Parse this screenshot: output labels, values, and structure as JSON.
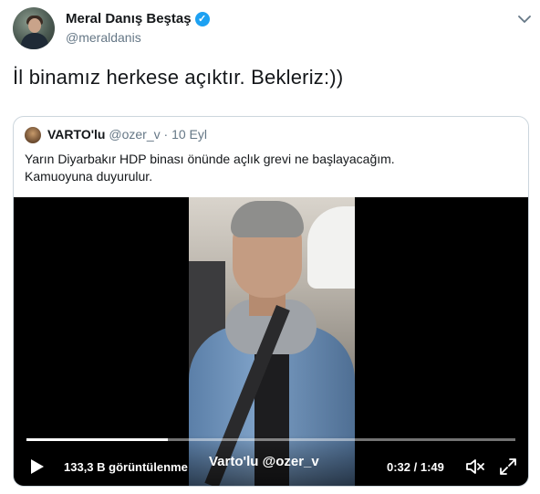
{
  "tweet": {
    "author_name": "Meral Danış Beştaş",
    "author_handle": "@meraldanis",
    "text": "İl binamız herkese açıktır. Bekleriz:))",
    "verified_icon": "verified-badge-icon",
    "more_icon": "chevron-down-icon"
  },
  "quote": {
    "author_name": "VARTO'lu",
    "author_handle": "@ozer_v",
    "separator": " · ",
    "date": "10 Eyl",
    "text_lines": [
      "Yarın Diyarbakır HDP binası önünde açlık grevi ne başlayacağım.",
      "Kamuoyuna duyurulur."
    ]
  },
  "video": {
    "views": "133,3 B görüntülenme",
    "watermark": "Varto'lu @ozer_v",
    "time": "0:32 / 1:49",
    "progress_fraction": 0.29,
    "icons": {
      "play": "play-icon",
      "mute": "muted-speaker-icon",
      "fullscreen": "fullscreen-icon"
    }
  },
  "colors": {
    "accent": "#1da1f2",
    "text_primary": "#14171a",
    "text_secondary": "#657786",
    "border": "#ccd6dd"
  }
}
